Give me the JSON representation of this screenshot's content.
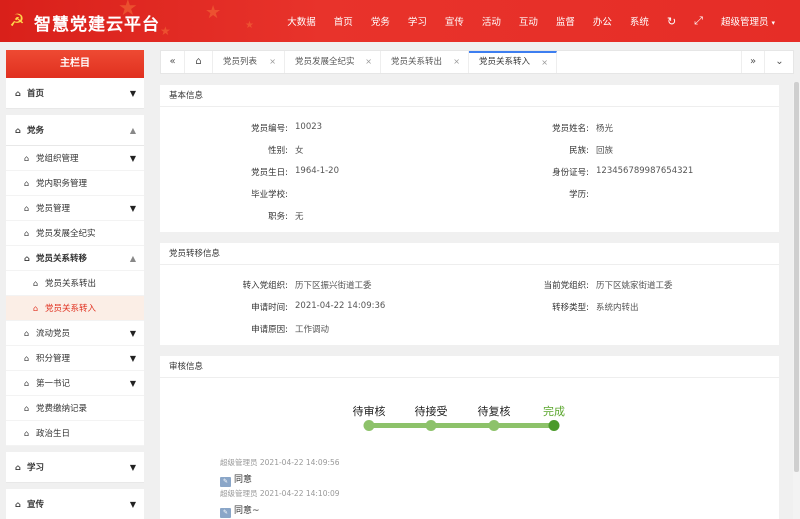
{
  "app": {
    "title": "智慧党建云平台"
  },
  "topnav": {
    "items": [
      "大数据",
      "首页",
      "党务",
      "学习",
      "宣传",
      "活动",
      "互动",
      "监督",
      "办公",
      "系统"
    ],
    "user": "超级管理员"
  },
  "sidebar": {
    "header": "主栏目",
    "items": {
      "home": "首页",
      "party_affairs": "党务",
      "org_manage": "党组织管理",
      "duty_manage": "党内职务管理",
      "member_manage": "党员管理",
      "development": "党员发展全纪实",
      "relation_transfer": "党员关系转移",
      "transfer_out": "党员关系转出",
      "transfer_in": "党员关系转入",
      "floating": "流动党员",
      "points": "积分管理",
      "secretary": "第一书记",
      "dues": "党费缴纳记录",
      "birthday": "政治生日",
      "study": "学习",
      "publicity": "宣传"
    }
  },
  "tabs": [
    "党员列表",
    "党员发展全纪实",
    "党员关系转出",
    "党员关系转入"
  ],
  "basic": {
    "title": "基本信息",
    "member_no_label": "党员编号:",
    "member_no": "10023",
    "name_label": "党员姓名:",
    "name": "杨光",
    "gender_label": "性别:",
    "gender": "女",
    "ethnic_label": "民族:",
    "ethnic": "回族",
    "birthday_label": "党员生日:",
    "birthday": "1964-1-20",
    "id_label": "身份证号:",
    "id_no": "123456789987654321",
    "school_label": "毕业学校:",
    "school": "",
    "edu_label": "学历:",
    "edu": "",
    "job_label": "职务:",
    "job": "无"
  },
  "transfer": {
    "title": "党员转移信息",
    "to_org_label": "转入党组织:",
    "to_org": "历下区振兴街道工委",
    "cur_org_label": "当前党组织:",
    "cur_org": "历下区姚家街道工委",
    "time_label": "申请时间:",
    "time": "2021-04-22 14:09:36",
    "type_label": "转移类型:",
    "type": "系统内转出",
    "reason_label": "申请原因:",
    "reason": "工作调动"
  },
  "review": {
    "title": "审核信息",
    "steps": [
      {
        "label": "待审核",
        "done": false
      },
      {
        "label": "待接受",
        "done": false
      },
      {
        "label": "待复核",
        "done": false
      },
      {
        "label": "完成",
        "done": true
      }
    ],
    "logs": [
      {
        "who": "超级管理员 2021-04-22 14:09:56",
        "msg": "同意"
      },
      {
        "who": "超级管理员 2021-04-22 14:10:09",
        "msg": "同意~"
      }
    ]
  },
  "colors": {
    "brand_red": "#e0301f",
    "step_green": "#8dc26a",
    "active_tab": "#3d7ef0"
  }
}
